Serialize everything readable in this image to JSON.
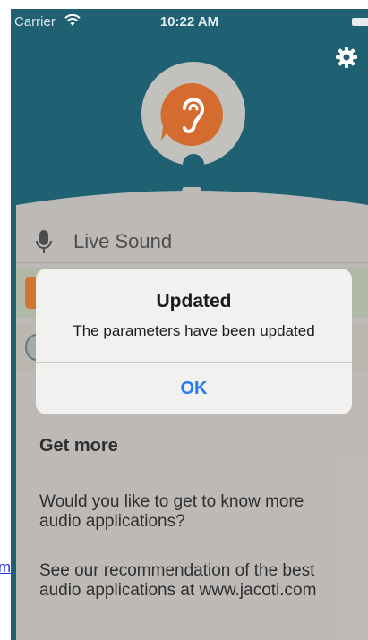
{
  "status_bar": {
    "carrier": "Carrier",
    "time": "10:22 AM"
  },
  "live_sound": {
    "label": "Live Sound"
  },
  "get_more": {
    "title": "Get more",
    "text1": "Would you like to get to know more audio applications?",
    "text2": "See our recommendation of the best audio applications at www.jacoti.com"
  },
  "alert": {
    "title": "Updated",
    "message": "The parameters have been updated",
    "ok_label": "OK"
  },
  "stray_link": {
    "text": "m"
  },
  "colors": {
    "accent": "#1f7cf5",
    "brand_orange": "#d1601f",
    "app_bg": "#0d5468"
  },
  "icons": [
    "wifi-icon",
    "battery-icon",
    "gear-icon",
    "ear-icon",
    "microphone-icon"
  ]
}
